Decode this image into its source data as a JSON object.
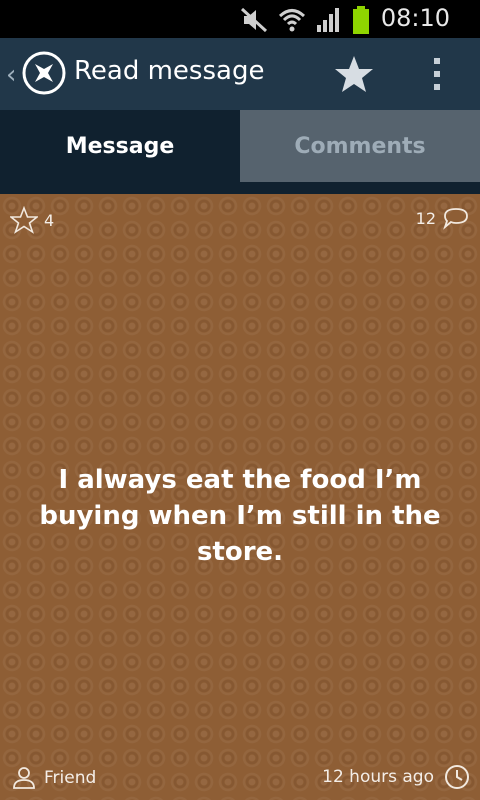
{
  "status_bar": {
    "time": "08:10",
    "icons": [
      "mute-icon",
      "wifi-icon",
      "signal-icon",
      "battery-icon"
    ]
  },
  "app_bar": {
    "title": "Read message",
    "back_icon": "chevron-left-icon",
    "logo_icon": "app-logo-icon",
    "star_icon": "star-icon",
    "overflow_icon": "overflow-menu-icon"
  },
  "tabs": [
    {
      "label": "Message",
      "active": true
    },
    {
      "label": "Comments",
      "active": false
    }
  ],
  "message_card": {
    "like_count": "4",
    "comment_count": "12",
    "text": "I always eat the food I’m buying when I’m still in the store.",
    "author": "Friend",
    "time_ago": "12 hours ago",
    "background_color": "#8e5e35"
  },
  "colors": {
    "appbar": "#213749",
    "tab_active": "#10212f",
    "tab_inactive": "#56636e"
  }
}
